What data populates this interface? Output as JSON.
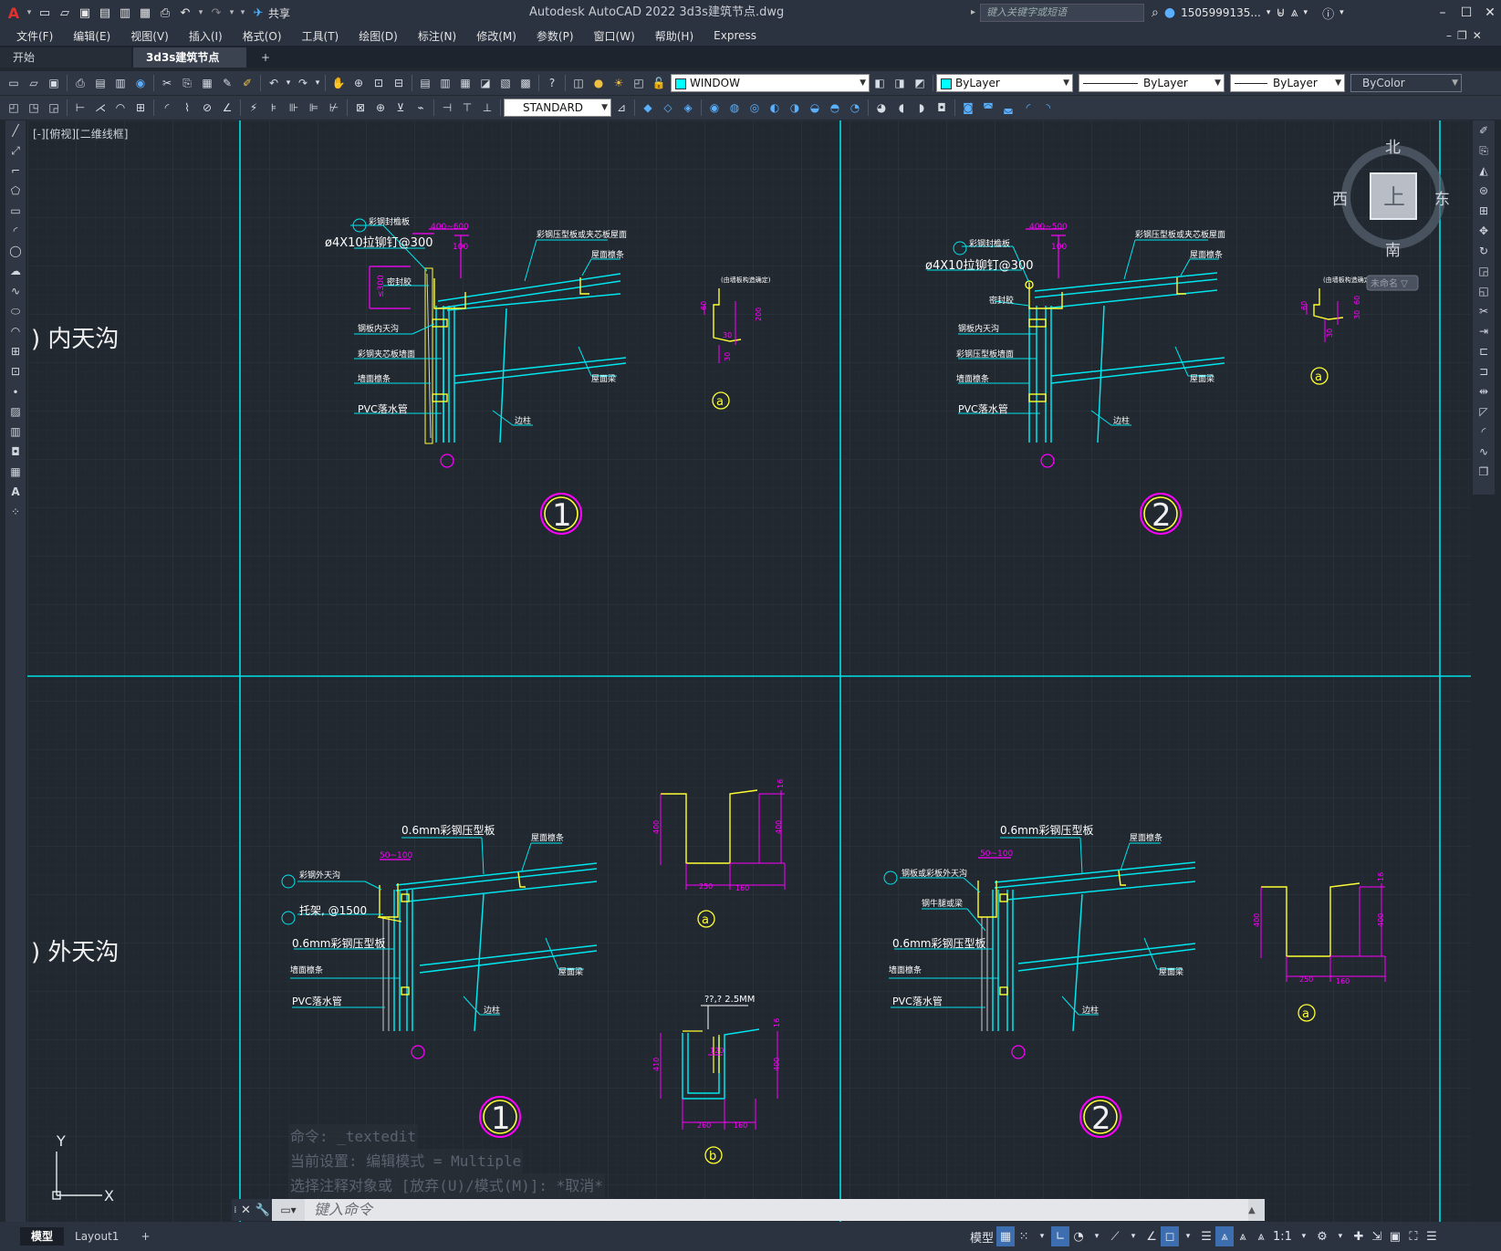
{
  "app": {
    "title": "Autodesk AutoCAD 2022    3d3s建筑节点.dwg",
    "share_label": "共享",
    "search_placeholder": "键入关键字或短语",
    "user": "1505999135..."
  },
  "menu": [
    "文件(F)",
    "编辑(E)",
    "视图(V)",
    "插入(I)",
    "格式(O)",
    "工具(T)",
    "绘图(D)",
    "标注(N)",
    "修改(M)",
    "参数(P)",
    "窗口(W)",
    "帮助(H)",
    "Express"
  ],
  "tabs": [
    {
      "label": "开始"
    },
    {
      "label": "3d3s建筑节点*",
      "close": "✕"
    }
  ],
  "tab_add": "+",
  "toolbar": {
    "layer_name": "WINDOW",
    "color": "ByLayer",
    "linetype": "ByLayer",
    "lineweight": "ByLayer",
    "plotstyle": "ByColor",
    "textstyle": "STANDARD"
  },
  "view_label": "[-][俯视][二维线框]",
  "viewcube": {
    "north": "北",
    "south": "南",
    "east": "东",
    "west": "西",
    "top": "上",
    "ucs": "未命名 ▽"
  },
  "ucs": {
    "x": "X",
    "y": "Y"
  },
  "drawing": {
    "section_inner": ") 内天沟",
    "section_outer": ") 外天沟",
    "d1": {
      "labels": [
        "彩钢封檐板",
        "ø4X10拉铆钉@300",
        "密封胶",
        "钢板内天沟",
        "彩钢夹芯板墙面",
        "墙面檩条",
        "PVC落水管",
        "彩钢压型板或夹芯板屋面",
        "屋面檩条",
        "屋面梁",
        "边柱"
      ],
      "dims": [
        "400~600",
        "100",
        "≤300"
      ],
      "number": "1"
    },
    "d2": {
      "labels": [
        "彩钢封檐板",
        "ø4X10拉铆钉@300",
        "密封胶",
        "钢板内天沟",
        "彩钢压型板墙面",
        "墙面檩条",
        "PVC落水管",
        "彩钢压型板或夹芯板屋面",
        "屋面檩条",
        "屋面梁",
        "边柱"
      ],
      "dims": [
        "400~500",
        "100"
      ],
      "number": "2"
    },
    "d3": {
      "labels": [
        "0.6mm彩钢压型板",
        "屋面檩条",
        "彩钢外天沟",
        "托架, @1500",
        "0.6mm彩钢压型板",
        "墙面檩条",
        "PVC落水管",
        "屋面梁",
        "边柱"
      ],
      "dims": [
        "50~100"
      ],
      "number": "1"
    },
    "d4": {
      "labels": [
        "0.6mm彩钢压型板",
        "屋面檩条",
        "钢板或彩板外天沟",
        "钢牛腿或梁",
        "0.6mm彩钢压型板",
        "墙面檩条",
        "PVC落水管",
        "屋面梁",
        "边柱"
      ],
      "dims": [
        "50~100"
      ],
      "number": "2"
    },
    "gutter_a1": {
      "note": "(由墙板构造确定)",
      "dims": [
        "60",
        "200",
        "30",
        "30"
      ],
      "tag": "a"
    },
    "gutter_a2": {
      "note": "(由墙板构造确定)",
      "dims": [
        "60",
        "30",
        "60",
        "30"
      ],
      "tag": "a"
    },
    "gutter_b1": {
      "dims": [
        "400",
        "400",
        "250",
        "160",
        "16"
      ],
      "tag": "a"
    },
    "gutter_b2": {
      "title": "??,? 2.5MM",
      "dims": [
        "410",
        "400",
        "120",
        "260",
        "160",
        "16"
      ],
      "tag": "b"
    },
    "gutter_b3": {
      "dims": [
        "400",
        "400",
        "250",
        "160",
        "16"
      ],
      "tag": "a"
    }
  },
  "command": {
    "history": [
      "命令: _textedit",
      "当前设置: 编辑模式 = Multiple",
      "选择注释对象或 [放弃(U)/模式(M)]: *取消*"
    ],
    "placeholder": "键入命令"
  },
  "status": {
    "layout_tabs": [
      "模型",
      "Layout1"
    ],
    "model_label": "模型",
    "scale": "1:1"
  },
  "colors": {
    "grid": "#2c3440",
    "cyan": "#00e5ee",
    "magenta": "#ff00ff",
    "yellow": "#ffff33",
    "white": "#f0f0f0"
  }
}
